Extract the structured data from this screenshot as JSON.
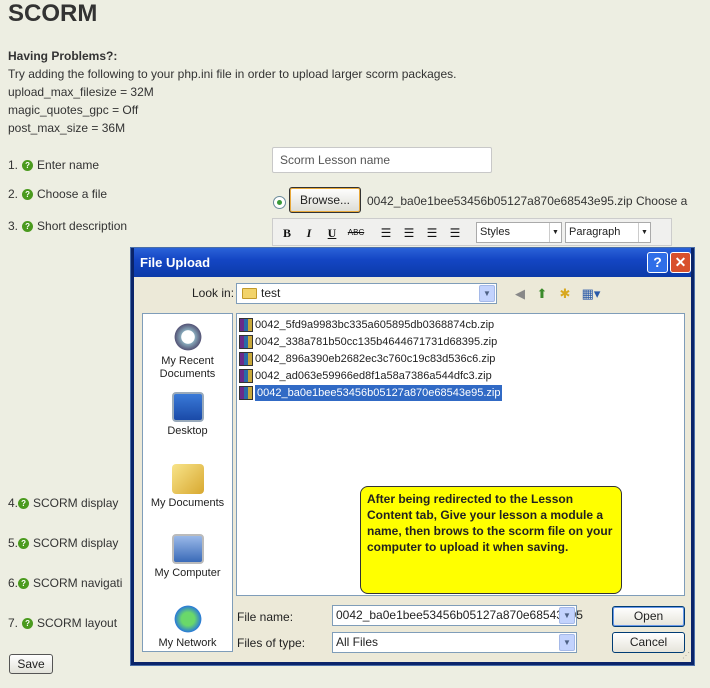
{
  "page": {
    "title": "SCORM",
    "help_title": "Having Problems?:",
    "help_lines": [
      "Try adding the following to your php.ini file in order to upload larger scorm packages.",
      "upload_max_filesize = 32M",
      "magic_quotes_gpc = Off",
      "post_max_size = 36M"
    ],
    "steps": [
      "1. ",
      "Enter name",
      "2. ",
      "Choose a file",
      "3. ",
      "Short description",
      "4. ",
      "SCORM display",
      "5. ",
      "SCORM display",
      "6. ",
      "SCORM navigati",
      "7. ",
      "SCORM layout"
    ],
    "name_placeholder": "Scorm Lesson name",
    "browse_label": "Browse...",
    "chosen_file": "0042_ba0e1bee53456b05127a870e68543e95.zip",
    "choose_a": "Choose a",
    "toolbar": {
      "bold": "B",
      "italic": "I",
      "underline": "U",
      "strike": "ABC",
      "styles": "Styles",
      "format": "Paragraph"
    },
    "save_label": "Save"
  },
  "dialog": {
    "title": "File Upload",
    "look_in_label": "Look in:",
    "look_in_value": "test",
    "places": [
      "My Recent Documents",
      "Desktop",
      "My Documents",
      "My Computer",
      "My Network"
    ],
    "files": [
      "0042_5fd9a9983bc335a605895db0368874cb.zip",
      "0042_338a781b50cc135b4644671731d68395.zip",
      "0042_896a390eb2682ec3c760c19c83d536c6.zip",
      "0042_ad063e59966ed8f1a58a7386a544dfc3.zip",
      "0042_ba0e1bee53456b05127a870e68543e95.zip"
    ],
    "selected_index": 4,
    "note": "After being redirected to the Lesson Content tab, Give your lesson a module a name, then brows to the scorm file on your computer to upload it when saving.",
    "file_name_label": "File name:",
    "file_name_value": "0042_ba0e1bee53456b05127a870e68543e95",
    "file_type_label": "Files of type:",
    "file_type_value": "All Files",
    "open_label": "Open",
    "cancel_label": "Cancel",
    "help_button": "?",
    "close_button": "✕"
  }
}
